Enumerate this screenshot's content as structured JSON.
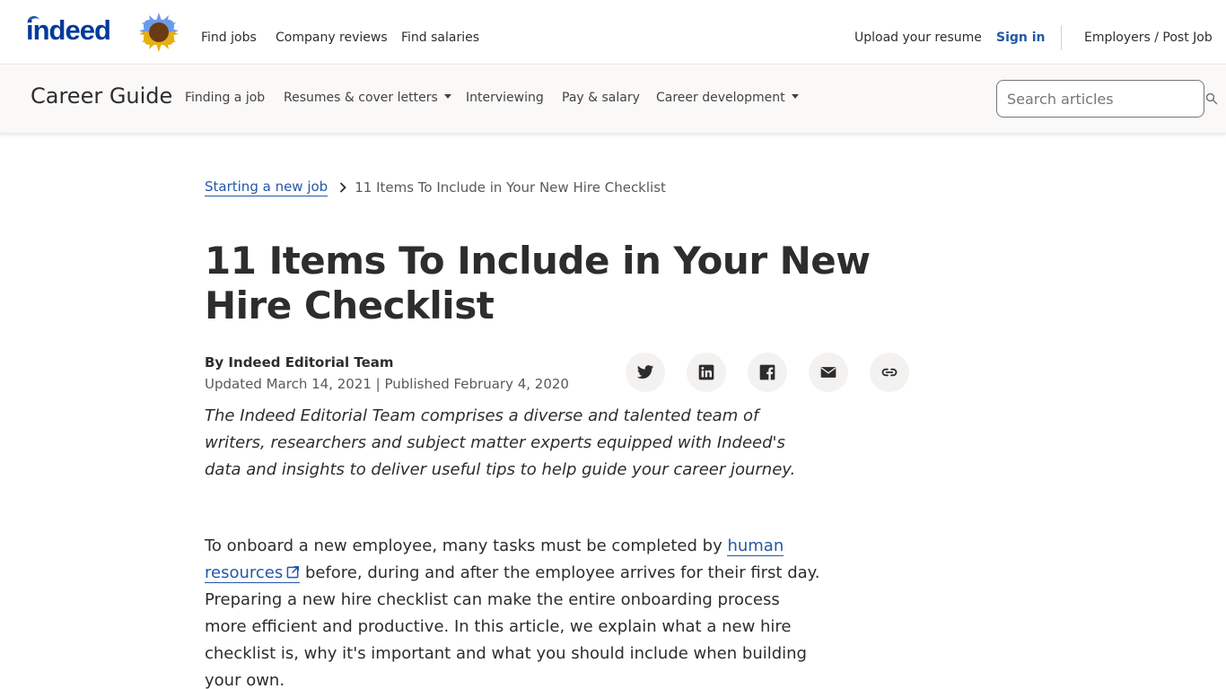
{
  "header": {
    "logo_text": "indeed",
    "nav": [
      "Find jobs",
      "Company reviews",
      "Find salaries"
    ],
    "upload_resume": "Upload your resume",
    "sign_in": "Sign in",
    "employers": "Employers / Post Job"
  },
  "guide": {
    "title": "Career Guide",
    "links": [
      {
        "label": "Finding a job",
        "dropdown": false
      },
      {
        "label": "Resumes & cover letters",
        "dropdown": true
      },
      {
        "label": "Interviewing",
        "dropdown": false
      },
      {
        "label": "Pay & salary",
        "dropdown": false
      },
      {
        "label": "Career development",
        "dropdown": true
      }
    ],
    "search_placeholder": "Search articles",
    "search_value": ""
  },
  "breadcrumb": {
    "parent": "Starting a new job",
    "current": "11 Items To Include in Your New Hire Checklist"
  },
  "article": {
    "title": "11 Items To Include in Your New Hire Checklist",
    "byline": "By Indeed Editorial Team",
    "dates": "Updated March 14, 2021 | Published February 4, 2020",
    "share": [
      "twitter-icon",
      "linkedin-icon",
      "facebook-icon",
      "email-icon",
      "link-icon"
    ],
    "blurb": "The Indeed Editorial Team comprises a diverse and talented team of writers, researchers and subject matter experts equipped with Indeed's data and insights to deliver useful tips to help guide your career journey.",
    "intro_before_link": "To onboard a new employee, many tasks must be completed by ",
    "intro_link": "human resources",
    "intro_after_link": " before, during and after the employee arrives for their first day. Preparing a new hire checklist can make the entire onboarding process more efficient and productive. In this article, we explain what a new hire checklist is, why it's important and what you should include when building your own."
  },
  "colors": {
    "brand_blue": "#2557a7",
    "logo_blue": "#003a9b",
    "text": "#2d2d2d",
    "muted": "#595959",
    "bar_bg": "#faf9f8",
    "share_bg": "#f3f2f1"
  }
}
